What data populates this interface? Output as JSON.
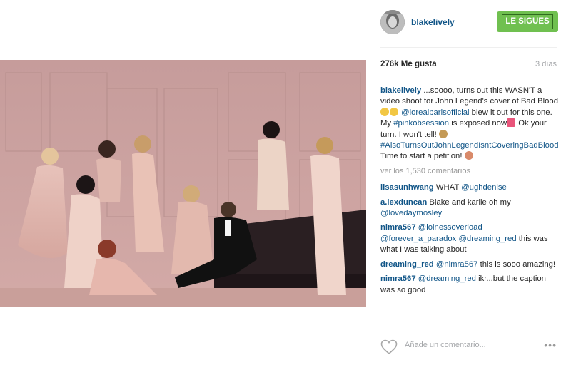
{
  "post": {
    "username": "blakelively",
    "follow_label": "LE SIGUES",
    "likes": "276k Me gusta",
    "time_ago": "3 días"
  },
  "caption": {
    "username": "blakelively",
    "text1": " ...soooo, turns out this WASN'T a video shoot for John Legend's cover of Bad Blood ",
    "mention1": "@lorealparisofficial",
    "text2": " blew it out for this one. My ",
    "hashtag1": "#pinkobsession",
    "text3": " is exposed now",
    "text4": " Ok your turn. I won't tell! ",
    "hashtag2": "#AlsoTurnsOutJohnLegendIsntCoveringBadBlood",
    "text5": " Time to start a petition! "
  },
  "view_all_comments": "ver los 1,530 comentarios",
  "comments": [
    {
      "user": "lisasunhwang",
      "mention": "@ughdenise",
      "pre": " WHAT ",
      "post": ""
    },
    {
      "user": "a.lexduncan",
      "pre": " Blake and karlie oh my ",
      "mention": "@lovedaymosley",
      "post": ""
    },
    {
      "user": "nimra567",
      "pre": " ",
      "mention": "@lolnessoverload",
      "mention2": "@forever_a_paradox",
      "mention3": "@dreaming_red",
      "post": " this was what I was talking about"
    },
    {
      "user": "dreaming_red",
      "pre": " ",
      "mention": "@nimra567",
      "post": " this is sooo amazing!"
    },
    {
      "user": "nimra567",
      "pre": " ",
      "mention": "@dreaming_red",
      "post": " ikr...but the caption was so good"
    }
  ],
  "add_comment": {
    "placeholder": "Añade un comentario..."
  },
  "icons": {
    "like": "heart-icon",
    "more": "ellipsis-icon"
  },
  "colors": {
    "follow_button": "#70c050",
    "link": "#125688",
    "muted": "#a5a7aa",
    "background_photo": "#d9b3b1"
  }
}
